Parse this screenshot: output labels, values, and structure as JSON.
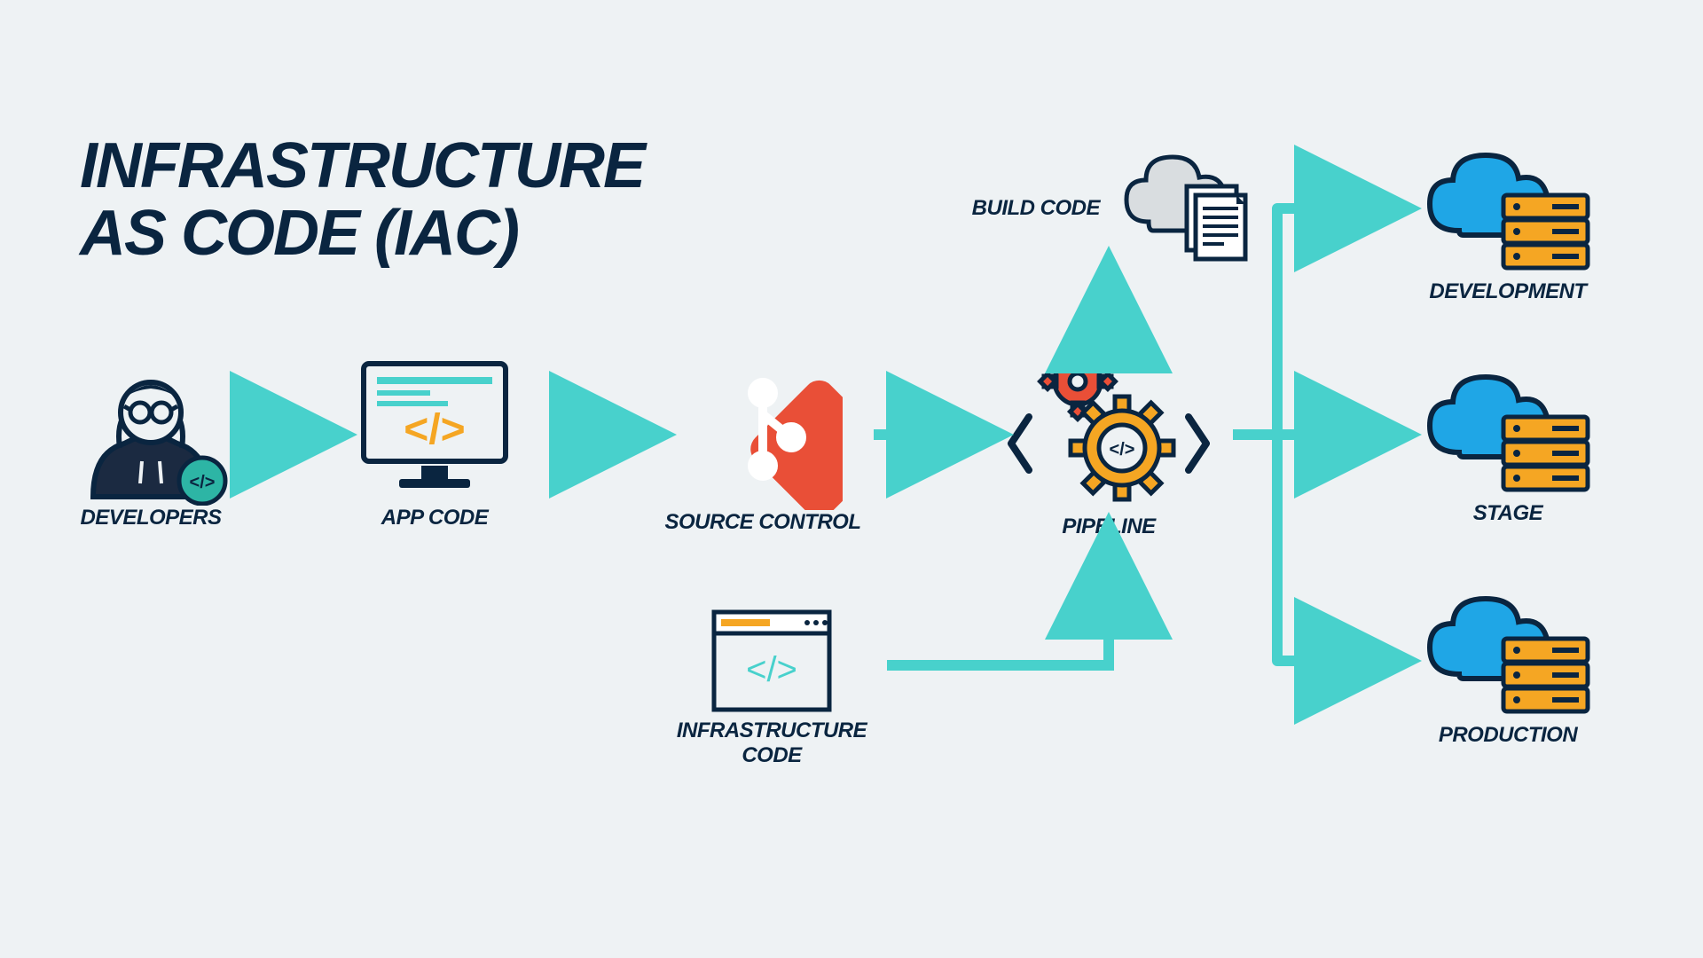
{
  "title_line1": "INFRASTRUCTURE",
  "title_line2": "AS CODE (IAC)",
  "nodes": {
    "developers": "DEVELOPERS",
    "app_code": "APP CODE",
    "source_control": "SOURCE CONTROL",
    "pipeline": "PIPELINE",
    "build_code": "BUILD CODE",
    "infrastructure_code": "INFRASTRUCTURE CODE",
    "development": "DEVELOPMENT",
    "stage": "STAGE",
    "production": "PRODUCTION"
  },
  "colors": {
    "arrow": "#48d1cc",
    "text": "#0a2540",
    "orange": "#f5a623",
    "red": "#e94f37",
    "blue": "#1fa6e6",
    "dark": "#1b2a41"
  }
}
